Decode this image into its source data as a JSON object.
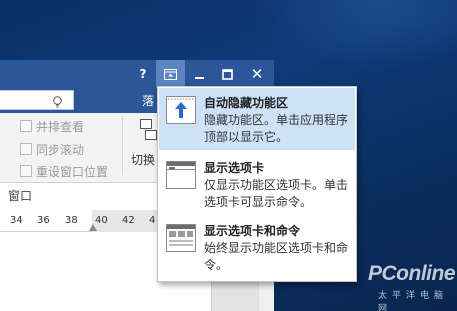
{
  "window": {
    "help_label": "?",
    "ribbon_display_icon": "ribbon-display-options-icon",
    "minimize_icon": "minimize-icon",
    "maximize_icon": "maximize-icon",
    "close_label": "✕",
    "tab_fragment": "落",
    "accent_color": "#2b579a"
  },
  "ribbon": {
    "view_items": [
      {
        "label": "并排查看",
        "icon": "side-by-side-icon"
      },
      {
        "label": "同步滚动",
        "icon": "sync-scroll-icon"
      },
      {
        "label": "重设窗口位置",
        "icon": "reset-window-position-icon"
      }
    ],
    "switch_label": "切换",
    "group_label": "窗口"
  },
  "ruler": {
    "ticks": [
      "34",
      "36",
      "38",
      "40",
      "42",
      "4"
    ]
  },
  "menu": {
    "items": [
      {
        "title": "自动隐藏功能区",
        "desc": "隐藏功能区。单击应用程序顶部以显示它。",
        "icon": "auto-hide-ribbon-icon",
        "selected": true
      },
      {
        "title": "显示选项卡",
        "desc": "仅显示功能区选项卡。单击选项卡可显示命令。",
        "icon": "show-tabs-icon",
        "selected": false
      },
      {
        "title": "显示选项卡和命令",
        "desc": "始终显示功能区选项卡和命令。",
        "icon": "show-tabs-and-commands-icon",
        "selected": false
      }
    ]
  },
  "watermark": {
    "brand": "PConline",
    "sub": "太平洋电脑网"
  }
}
